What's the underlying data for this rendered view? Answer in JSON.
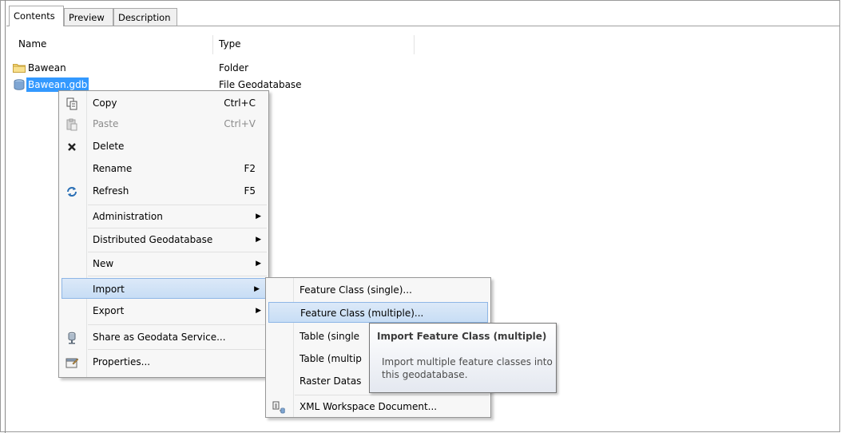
{
  "tabs": [
    "Contents",
    "Preview",
    "Description"
  ],
  "columns": {
    "name": "Name",
    "type": "Type"
  },
  "rows": [
    {
      "name": "Bawean",
      "type": "Folder",
      "icon": "folder-icon"
    },
    {
      "name": "Bawean.gdb",
      "type": "File Geodatabase",
      "icon": "geodatabase-icon"
    }
  ],
  "context_menu": {
    "copy": {
      "label": "Copy",
      "shortcut": "Ctrl+C"
    },
    "paste": {
      "label": "Paste",
      "shortcut": "Ctrl+V"
    },
    "delete": {
      "label": "Delete"
    },
    "rename": {
      "label": "Rename",
      "shortcut": "F2"
    },
    "refresh": {
      "label": "Refresh",
      "shortcut": "F5"
    },
    "administration": {
      "label": "Administration"
    },
    "distributed": {
      "label": "Distributed Geodatabase"
    },
    "new": {
      "label": "New"
    },
    "import": {
      "label": "Import"
    },
    "export": {
      "label": "Export"
    },
    "share": {
      "label": "Share as Geodata Service..."
    },
    "properties": {
      "label": "Properties..."
    }
  },
  "import_submenu": {
    "feature_single": "Feature Class (single)...",
    "feature_multiple": "Feature Class (multiple)...",
    "table_single": "Table (single",
    "table_multiple": "Table (multip",
    "raster": "Raster Datas",
    "xml": "XML Workspace Document..."
  },
  "tooltip": {
    "title": "Import Feature Class (multiple)",
    "body": "Import multiple feature classes into this geodatabase."
  },
  "colors": {
    "selection": "#3399ff",
    "menu_highlight": "#c7ddf5"
  }
}
